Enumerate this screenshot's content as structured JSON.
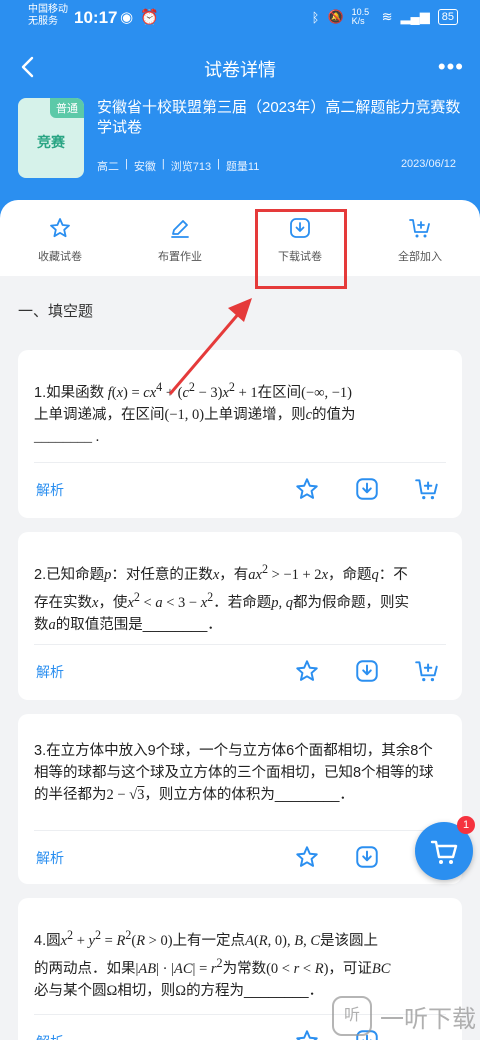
{
  "status": {
    "carrier_line1": "中国移动",
    "carrier_line2": "无服务",
    "time": "10:17",
    "speed": "10.5 K/s",
    "battery": "85"
  },
  "nav": {
    "title": "试卷详情"
  },
  "paper": {
    "tag": "普通",
    "thumb_label": "竞赛",
    "title": "安徽省十校联盟第三届（2023年）高二解题能力竞赛数学试卷",
    "grade": "高二",
    "region": "安徽",
    "views": "浏览713",
    "count": "题量11",
    "date": "2023/06/12"
  },
  "actions": {
    "favorite": "收藏试卷",
    "assign": "布置作业",
    "download": "下载试卷",
    "add_all": "全部加入"
  },
  "section": {
    "title": "一、填空题"
  },
  "questions": [
    {
      "analysis": "解析"
    },
    {
      "analysis": "解析"
    },
    {
      "analysis": "解析"
    },
    {
      "analysis": "解析"
    }
  ],
  "cart": {
    "badge": "1"
  },
  "watermark": {
    "text": "一听下载",
    "logo": "听"
  },
  "colors": {
    "primary": "#2b8ff0",
    "highlight": "#e53a3a",
    "badge": "#f5333f"
  }
}
